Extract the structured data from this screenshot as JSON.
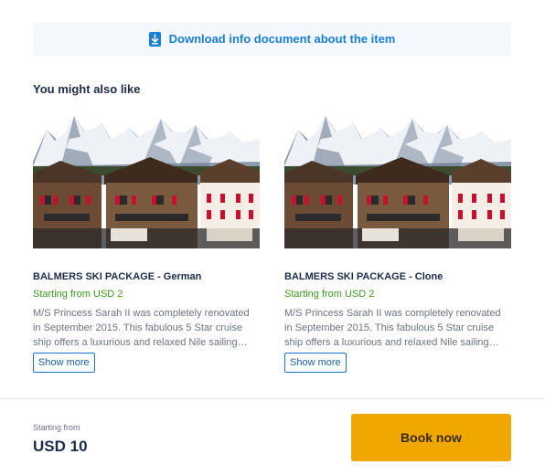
{
  "download": {
    "label": "Download info document about the item",
    "icon": "download-icon",
    "color": "#1a7fd4"
  },
  "related": {
    "title": "You might also like",
    "items": [
      {
        "name": "BALMERS SKI PACKAGE - German",
        "price": "Starting from USD 2",
        "description": "M/S Princess Sarah II was completely renovated in September 2015. This fabulous 5 Star cruise ship offers a luxurious and relaxed Nile sailing experience.",
        "show_more": "Show more"
      },
      {
        "name": "BALMERS SKI PACKAGE - Clone",
        "price": "Starting from USD 2",
        "description": "M/S Princess Sarah II was completely renovated in September 2015. This fabulous 5 Star cruise ship offers a luxurious and relaxed Nile sailing experience.",
        "show_more": "Show more"
      }
    ]
  },
  "footer": {
    "starting_label": "Starting from",
    "price": "USD 10",
    "book_label": "Book now",
    "book_color": "#f0a800"
  },
  "colors": {
    "price_green": "#3a9a1c",
    "link_blue": "#1a73c8",
    "heading": "#1c2b4a"
  }
}
